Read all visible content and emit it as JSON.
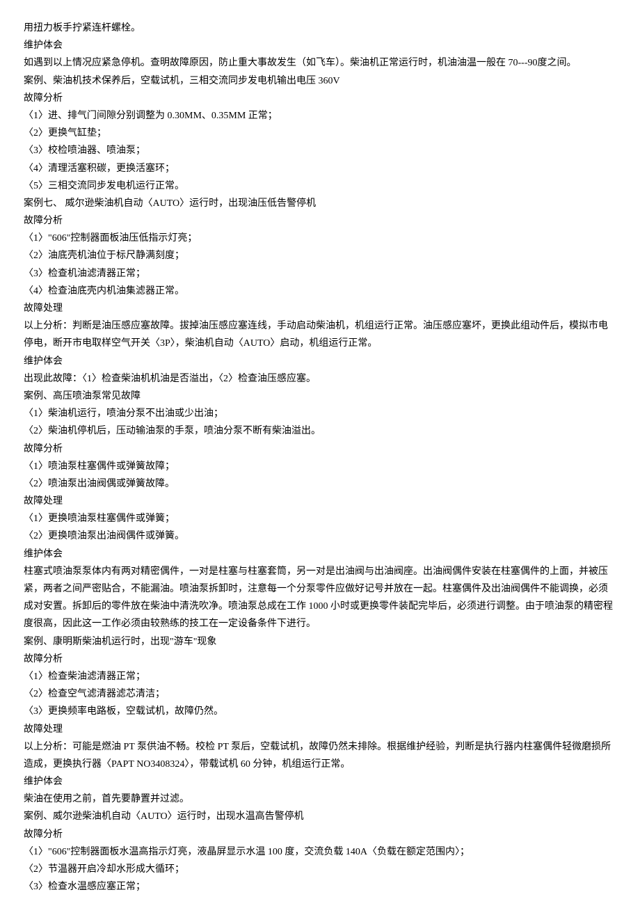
{
  "lines": [
    "用扭力板手拧紧连杆螺栓。",
    "维护体会",
    "如遇到以上情况应紧急停机。查明故障原因，防止重大事故发生（如飞车）。柴油机正常运行时，机油油温一般在 70---90度之间。",
    "案例、柴油机技术保养后，空载试机，三相交流同步发电机输出电压 360V",
    "故障分析",
    "〈1〉进、排气门间隙分别调整为 0.30MM、0.35MM 正常；",
    "〈2〉更换气缸垫；",
    "〈3〉校检喷油器、喷油泵；",
    "〈4〉清理活塞积碳，更换活塞环；",
    "〈5〉三相交流同步发电机运行正常。",
    "案例七、 威尔逊柴油机自动〈AUTO〉运行时，出现油压低告警停机",
    "故障分析",
    "〈1〉\"606\"控制器面板油压低指示灯亮；",
    "〈2〉油底壳机油位于标尺静满刻度；",
    "〈3〉检查机油滤清器正常；",
    "〈4〉检查油底壳内机油集滤器正常。",
    "故障处理",
    "以上分析：判断是油压感应塞故障。拔掉油压感应塞连线，手动启动柴油机，机组运行正常。油压感应塞坏，更换此组动件后，模拟市电停电，断开市电取样空气开关〈3P〉，柴油机自动〈AUTO〉启动，机组运行正常。",
    "维护体会",
    "出现此故障：〈1〉检查柴油机机油是否溢出，〈2〉检查油压感应塞。",
    "案例、高压喷油泵常见故障",
    "〈1〉柴油机运行，喷油分泵不出油或少出油；",
    "〈2〉柴油机停机后，压动输油泵的手泵，喷油分泵不断有柴油溢出。",
    "故障分析",
    "〈1〉喷油泵柱塞偶件或弹簧故障；",
    "〈2〉喷油泵出油阀偶或弹簧故障。",
    "故障处理",
    "〈1〉更换喷油泵柱塞偶件或弹簧；",
    "〈2〉更换喷油泵出油阀偶件或弹簧。",
    "维护体会",
    "柱塞式喷油泵泵体内有两对精密偶件，一对是柱塞与柱塞套筒，另一对是出油阀与出油阀座。出油阀偶件安装在柱塞偶件的上面，并被压紧，两者之间严密贴合，不能漏油。喷油泵拆卸时，注意每一个分泵零件应做好记号并放在一起。柱塞偶件及出油阀偶件不能调换，必须成对安置。拆卸后的零件放在柴油中清洗吹净。喷油泵总成在工作 1000 小时或更换零件装配完毕后，必须进行调整。由于喷油泵的精密程度很高，因此这一工作必须由较熟练的技工在一定设备条件下进行。",
    "案例、康明斯柴油机运行时，出现\"游车\"现象",
    "故障分析",
    "〈1〉检查柴油滤清器正常；",
    "〈2〉检查空气滤清器滤芯清洁；",
    "〈3〉更换频率电路板，空载试机，故障仍然。",
    "故障处理",
    "以上分析：可能是燃油 PT 泵供油不畅。校检 PT 泵后，空载试机，故障仍然未排除。根据维护经验，判断是执行器内柱塞偶件轻微磨损所造成，更换执行器〈PAPT  NO3408324〉，带载试机 60 分钟，机组运行正常。",
    "维护体会",
    "柴油在使用之前，首先要静置并过滤。",
    "案例、威尔逊柴油机自动〈AUTO〉运行时，出现水温高告警停机",
    "故障分析",
    "〈1〉\"606\"控制器面板水温高指示灯亮，液晶屏显示水温 100 度，交流负载 140A〈负载在额定范围内〉；",
    "〈2〉节温器开启冷却水形成大循环；",
    "〈3〉检查水温感应塞正常；"
  ]
}
